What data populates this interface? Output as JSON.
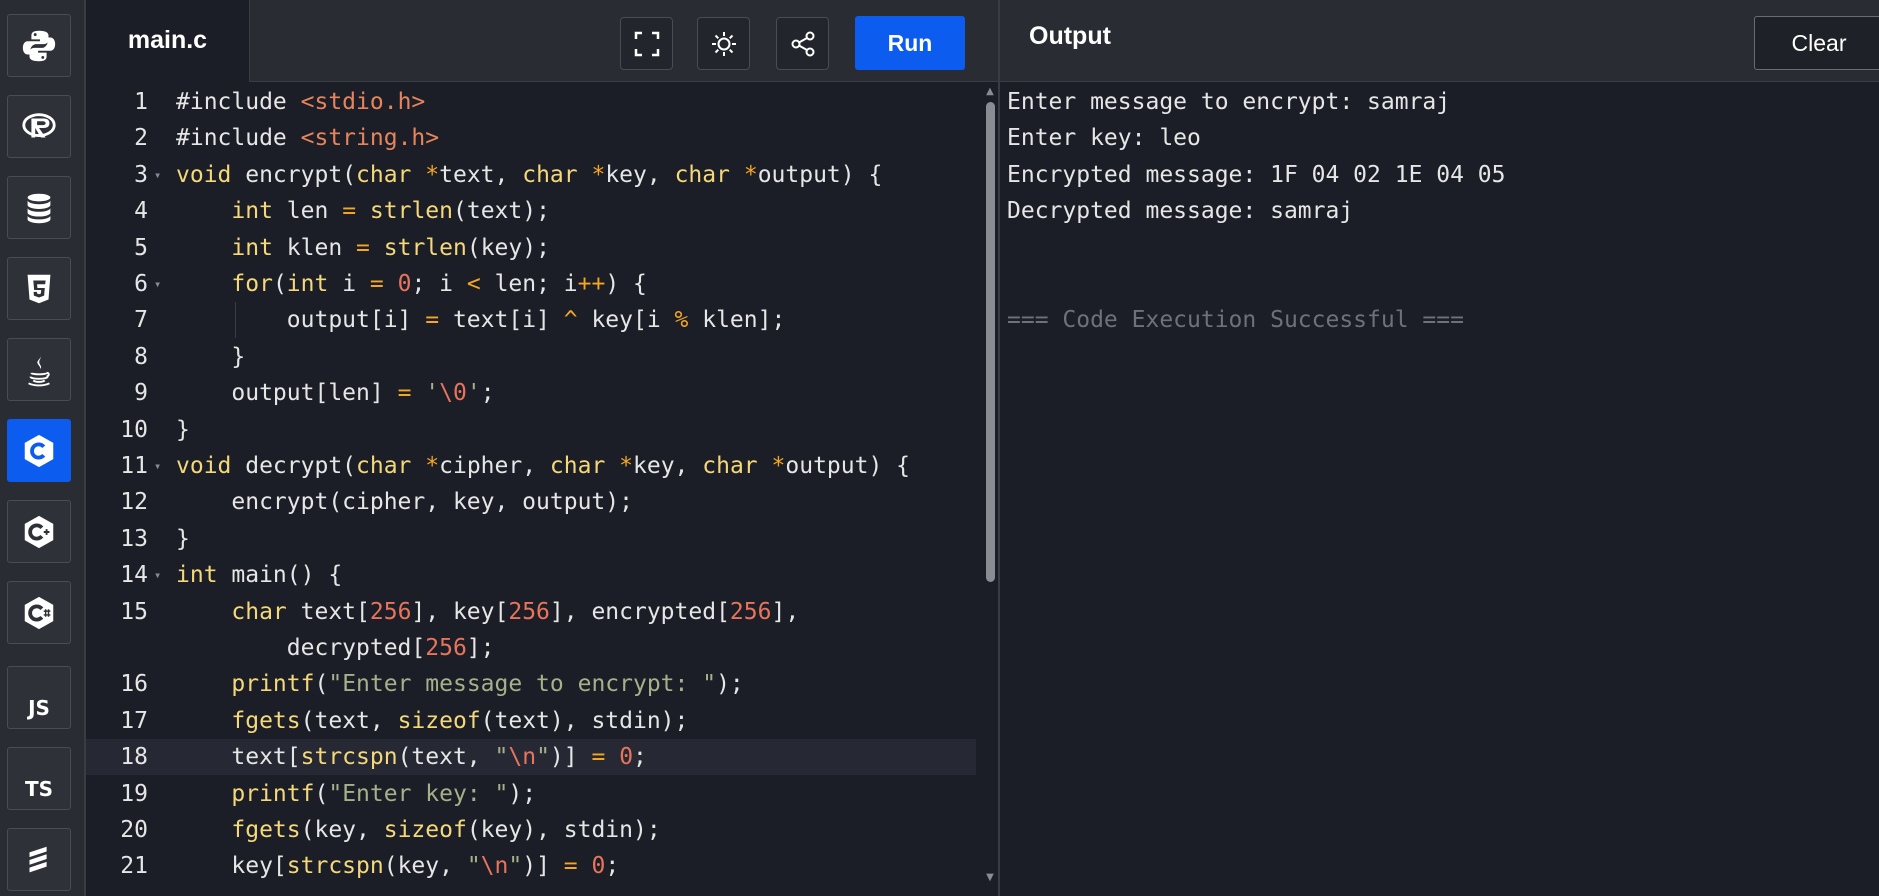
{
  "sidebar": {
    "languages": [
      {
        "name": "python-icon",
        "label": ""
      },
      {
        "name": "r-icon",
        "label": ""
      },
      {
        "name": "database-icon",
        "label": ""
      },
      {
        "name": "html5-icon",
        "label": ""
      },
      {
        "name": "java-icon",
        "label": ""
      },
      {
        "name": "c-icon",
        "label": "",
        "active": true
      },
      {
        "name": "cpp-icon",
        "label": ""
      },
      {
        "name": "csharp-icon",
        "label": ""
      },
      {
        "name": "javascript-icon",
        "label": "JS"
      },
      {
        "name": "typescript-icon",
        "label": "TS"
      },
      {
        "name": "swift-icon",
        "label": ""
      }
    ]
  },
  "editor": {
    "file_name": "main.c",
    "tools": [
      "fullscreen-icon",
      "theme-toggle-icon",
      "share-icon"
    ],
    "run_label": "Run",
    "active_line": 18,
    "lines": [
      {
        "n": "1",
        "text": "#include <stdio.h>"
      },
      {
        "n": "2",
        "text": "#include <string.h>"
      },
      {
        "n": "3",
        "text": "void encrypt(char *text, char *key, char *output) {",
        "fold": true
      },
      {
        "n": "4",
        "text": "    int len = strlen(text);"
      },
      {
        "n": "5",
        "text": "    int klen = strlen(key);"
      },
      {
        "n": "6",
        "text": "    for(int i = 0; i < len; i++) {",
        "fold": true
      },
      {
        "n": "7",
        "text": "        output[i] = text[i] ^ key[i % klen];"
      },
      {
        "n": "8",
        "text": "    }"
      },
      {
        "n": "9",
        "text": "    output[len] = '\\0';"
      },
      {
        "n": "10",
        "text": "}"
      },
      {
        "n": "11",
        "text": "void decrypt(char *cipher, char *key, char *output) {",
        "fold": true
      },
      {
        "n": "12",
        "text": "    encrypt(cipher, key, output);"
      },
      {
        "n": "13",
        "text": "}"
      },
      {
        "n": "14",
        "text": "int main() {",
        "fold": true
      },
      {
        "n": "15",
        "text": "    char text[256], key[256], encrypted[256],"
      },
      {
        "n": "",
        "text": "        decrypted[256];"
      },
      {
        "n": "16",
        "text": "    printf(\"Enter message to encrypt: \");"
      },
      {
        "n": "17",
        "text": "    fgets(text, sizeof(text), stdin);"
      },
      {
        "n": "18",
        "text": "    text[strcspn(text, \"\\n\")] = 0;"
      },
      {
        "n": "19",
        "text": "    printf(\"Enter key: \");"
      },
      {
        "n": "20",
        "text": "    fgets(key, sizeof(key), stdin);"
      },
      {
        "n": "21",
        "text": "    key[strcspn(key, \"\\n\")] = 0;"
      }
    ]
  },
  "output": {
    "title": "Output",
    "clear_label": "Clear",
    "lines": [
      {
        "text": "Enter message to encrypt: samraj",
        "dim": false
      },
      {
        "text": "Enter key: leo",
        "dim": false
      },
      {
        "text": "Encrypted message: 1F 04 02 1E 04 05",
        "dim": false
      },
      {
        "text": "Decrypted message: samraj",
        "dim": false
      },
      {
        "text": "",
        "dim": false
      },
      {
        "text": "",
        "dim": false
      },
      {
        "text": "=== Code Execution Successful ===",
        "dim": true
      }
    ]
  },
  "colors": {
    "accent": "#0d5cf0",
    "background": "#1b1e26",
    "panel": "#2a2c34",
    "keyword": "#f5d87a",
    "number": "#e8745c",
    "string": "#a8b08a"
  }
}
